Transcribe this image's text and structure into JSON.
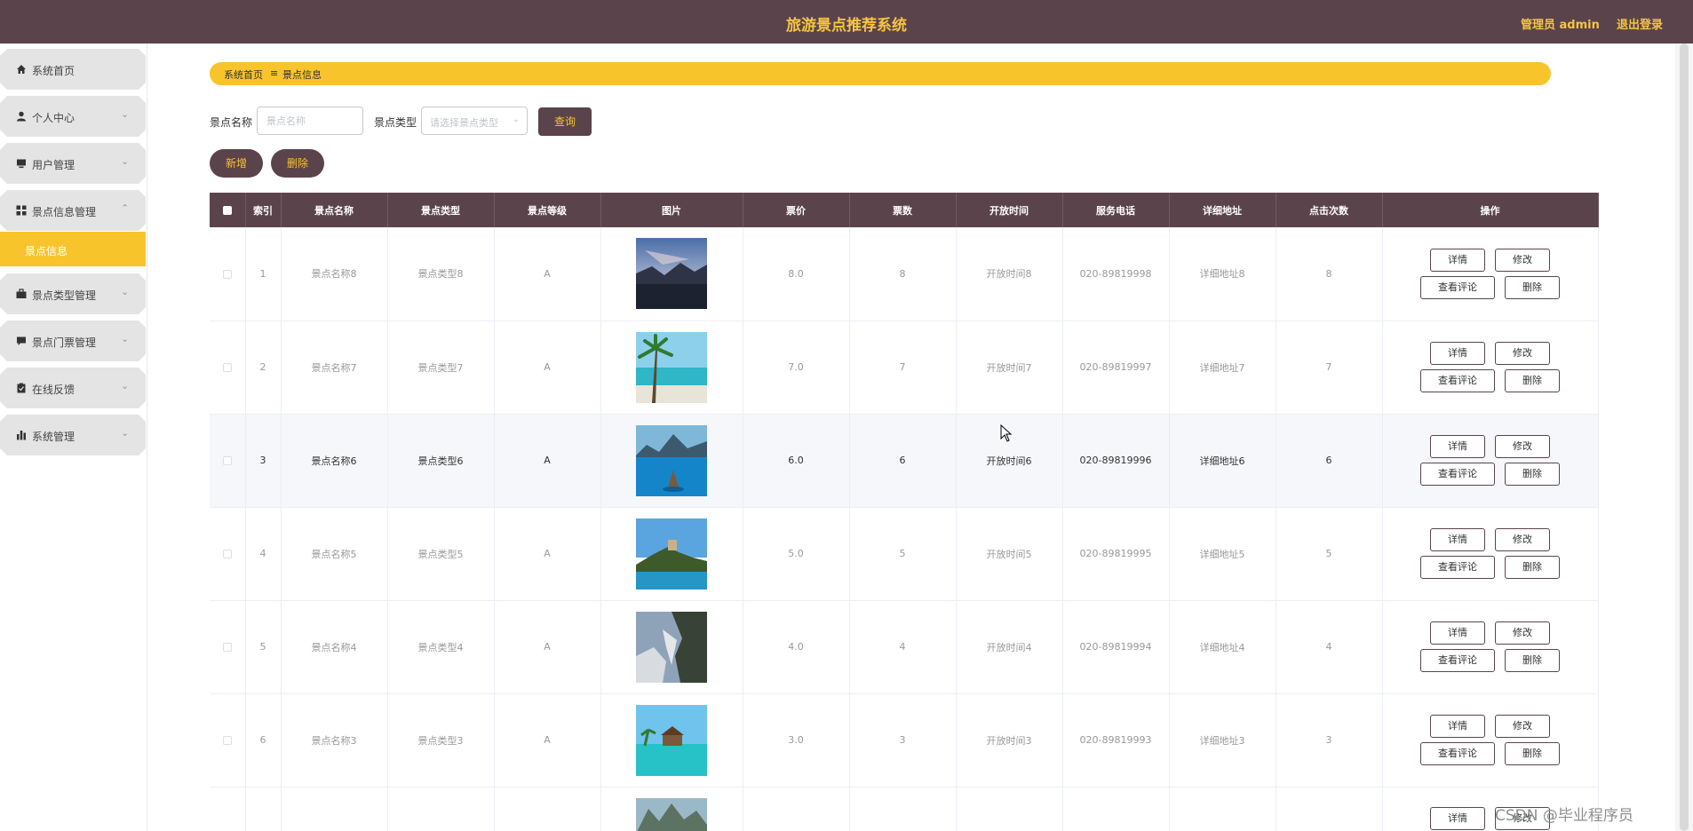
{
  "header": {
    "title": "旅游景点推荐系统",
    "user": "管理员 admin",
    "logout": "退出登录"
  },
  "sidebar": {
    "items": [
      {
        "label": "系统首页",
        "icon": "home-icon"
      },
      {
        "label": "个人中心",
        "icon": "user-icon"
      },
      {
        "label": "用户管理",
        "icon": "monitor-icon"
      },
      {
        "label": "景点信息管理",
        "icon": "grid-icon"
      },
      {
        "label": "景点类型管理",
        "icon": "briefcase-icon"
      },
      {
        "label": "景点门票管理",
        "icon": "chat-icon"
      },
      {
        "label": "在线反馈",
        "icon": "clipboard-icon"
      },
      {
        "label": "系统管理",
        "icon": "bar-chart-icon"
      }
    ],
    "submenu": "景点信息"
  },
  "breadcrumb": {
    "home": "系统首页",
    "sep": "≡",
    "current": "景点信息"
  },
  "search": {
    "name_label": "景点名称",
    "name_placeholder": "景点名称",
    "type_label": "景点类型",
    "type_placeholder": "请选择景点类型",
    "query_label": "查询"
  },
  "actions": {
    "add": "新增",
    "delete": "删除"
  },
  "table": {
    "columns": [
      "索引",
      "景点名称",
      "景点类型",
      "景点等级",
      "图片",
      "票价",
      "票数",
      "开放时间",
      "服务电话",
      "详细地址",
      "点击次数",
      "操作"
    ],
    "op_labels": {
      "detail": "详情",
      "edit": "修改",
      "comments": "查看评论",
      "delete": "删除"
    },
    "rows": [
      {
        "index": "1",
        "name": "景点名称8",
        "type": "景点类型8",
        "level": "A",
        "price": "8.0",
        "tickets": "8",
        "open_time": "开放时间8",
        "phone": "020-89819998",
        "address": "详细地址8",
        "clicks": "8"
      },
      {
        "index": "2",
        "name": "景点名称7",
        "type": "景点类型7",
        "level": "A",
        "price": "7.0",
        "tickets": "7",
        "open_time": "开放时间7",
        "phone": "020-89819997",
        "address": "详细地址7",
        "clicks": "7"
      },
      {
        "index": "3",
        "name": "景点名称6",
        "type": "景点类型6",
        "level": "A",
        "price": "6.0",
        "tickets": "6",
        "open_time": "开放时间6",
        "phone": "020-89819996",
        "address": "详细地址6",
        "clicks": "6"
      },
      {
        "index": "4",
        "name": "景点名称5",
        "type": "景点类型5",
        "level": "A",
        "price": "5.0",
        "tickets": "5",
        "open_time": "开放时间5",
        "phone": "020-89819995",
        "address": "详细地址5",
        "clicks": "5"
      },
      {
        "index": "5",
        "name": "景点名称4",
        "type": "景点类型4",
        "level": "A",
        "price": "4.0",
        "tickets": "4",
        "open_time": "开放时间4",
        "phone": "020-89819994",
        "address": "详细地址4",
        "clicks": "4"
      },
      {
        "index": "6",
        "name": "景点名称3",
        "type": "景点类型3",
        "level": "A",
        "price": "3.0",
        "tickets": "3",
        "open_time": "开放时间3",
        "phone": "020-89819993",
        "address": "详细地址3",
        "clicks": "3"
      }
    ]
  },
  "watermark": "CSDN @毕业程序员",
  "colors": {
    "header_bg": "#5b434c",
    "accent_yellow": "#f8c42b",
    "title_yellow": "#f5c542"
  }
}
